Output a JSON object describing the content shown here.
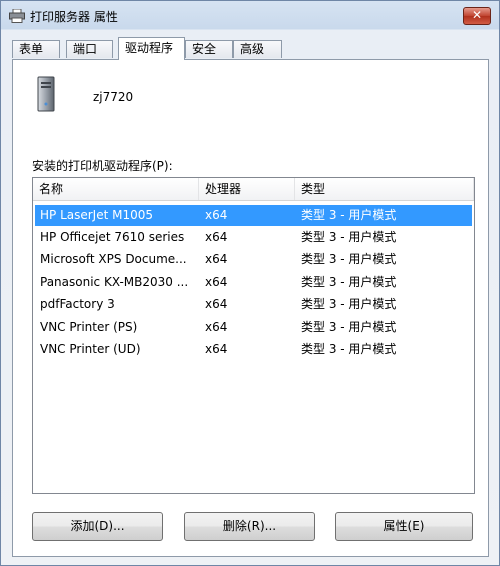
{
  "window": {
    "title": "打印服务器 属性",
    "close_label": "✕"
  },
  "tabs": [
    {
      "label": "表单"
    },
    {
      "label": "端口"
    },
    {
      "label": "驱动程序"
    },
    {
      "label": "安全"
    },
    {
      "label": "高级"
    }
  ],
  "server_name": "zj7720",
  "drivers_label": "安装的打印机驱动程序(P):",
  "list": {
    "columns": [
      "名称",
      "处理器",
      "类型"
    ],
    "rows": [
      {
        "name": "HP LaserJet M1005",
        "processor": "x64",
        "type": "类型 3 - 用户模式"
      },
      {
        "name": "HP Officejet 7610 series",
        "processor": "x64",
        "type": "类型 3 - 用户模式"
      },
      {
        "name": "Microsoft XPS Docume...",
        "processor": "x64",
        "type": "类型 3 - 用户模式"
      },
      {
        "name": "Panasonic KX-MB2030 ...",
        "processor": "x64",
        "type": "类型 3 - 用户模式"
      },
      {
        "name": "pdfFactory 3",
        "processor": "x64",
        "type": "类型 3 - 用户模式"
      },
      {
        "name": "VNC Printer (PS)",
        "processor": "x64",
        "type": "类型 3 - 用户模式"
      },
      {
        "name": "VNC Printer (UD)",
        "processor": "x64",
        "type": "类型 3 - 用户模式"
      }
    ]
  },
  "buttons": {
    "add": "添加(D)...",
    "remove": "删除(R)...",
    "properties": "属性(E)"
  },
  "colors": {
    "selection": "#3399ff",
    "close_button": "#c0432f"
  }
}
